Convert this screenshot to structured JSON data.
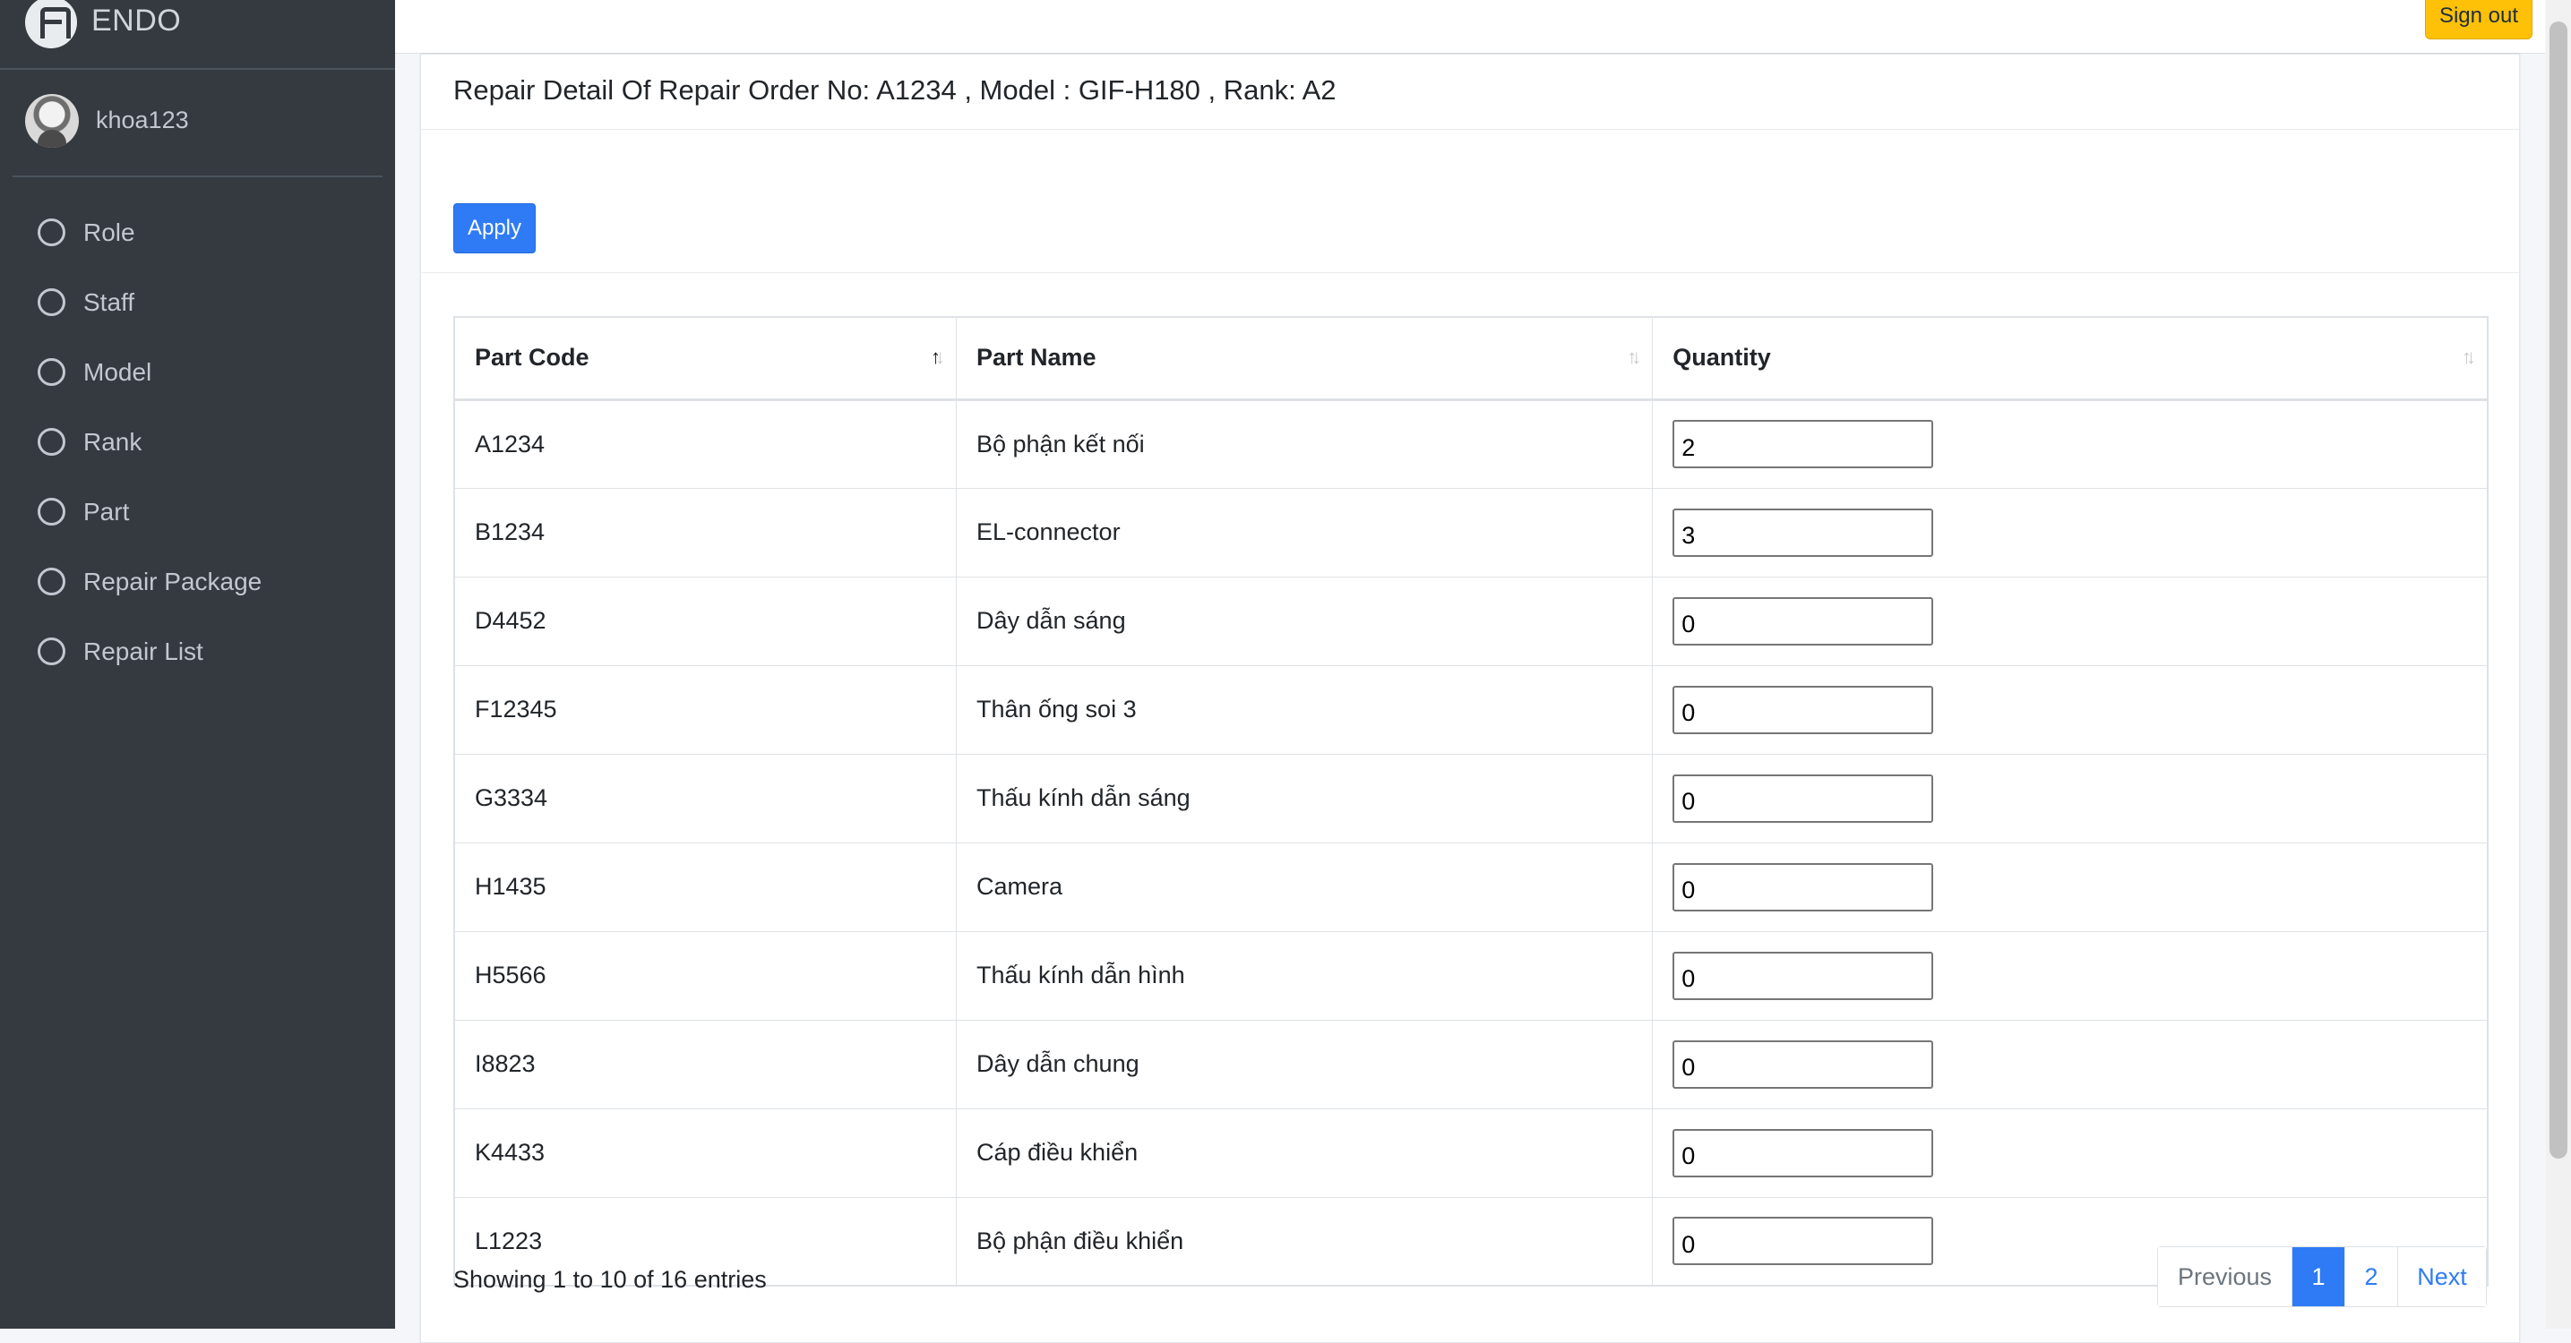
{
  "brand": {
    "name": "ENDO"
  },
  "user": {
    "name": "khoa123"
  },
  "sidebar": {
    "items": [
      {
        "label": "Role"
      },
      {
        "label": "Staff"
      },
      {
        "label": "Model"
      },
      {
        "label": "Rank"
      },
      {
        "label": "Part"
      },
      {
        "label": "Repair Package"
      },
      {
        "label": "Repair List"
      }
    ]
  },
  "topbar": {
    "signout_label": "Sign out"
  },
  "card": {
    "title": "Repair Detail Of Repair Order No: A1234 , Model : GIF-H180 , Rank: A2",
    "apply_label": "Apply"
  },
  "table": {
    "headers": {
      "code": "Part Code",
      "name": "Part Name",
      "qty": "Quantity"
    },
    "sort": {
      "column": "Part Code",
      "direction": "ascending"
    },
    "rows": [
      {
        "code": "A1234",
        "name": "Bộ phận kết nối",
        "qty": "2"
      },
      {
        "code": "B1234",
        "name": "EL-connector",
        "qty": "3"
      },
      {
        "code": "D4452",
        "name": "Dây dẫn sáng",
        "qty": "0"
      },
      {
        "code": "F12345",
        "name": "Thân ống soi 3",
        "qty": "0"
      },
      {
        "code": "G3334",
        "name": "Thấu kính dẫn sáng",
        "qty": "0"
      },
      {
        "code": "H1435",
        "name": "Camera",
        "qty": "0"
      },
      {
        "code": "H5566",
        "name": "Thấu kính dẫn hình",
        "qty": "0"
      },
      {
        "code": "I8823",
        "name": "Dây dẫn chung",
        "qty": "0"
      },
      {
        "code": "K4433",
        "name": "Cáp điều khiển",
        "qty": "0"
      },
      {
        "code": "L1223",
        "name": "Bộ phận điều khiển",
        "qty": "0"
      }
    ]
  },
  "footer": {
    "showing": "Showing 1 to 10 of 16 entries"
  },
  "pagination": {
    "previous": "Previous",
    "pages": [
      "1",
      "2"
    ],
    "current": "1",
    "next": "Next"
  },
  "colors": {
    "sidebar_bg": "#343a40",
    "primary": "#2f7bf5",
    "warning": "#ffc107"
  }
}
